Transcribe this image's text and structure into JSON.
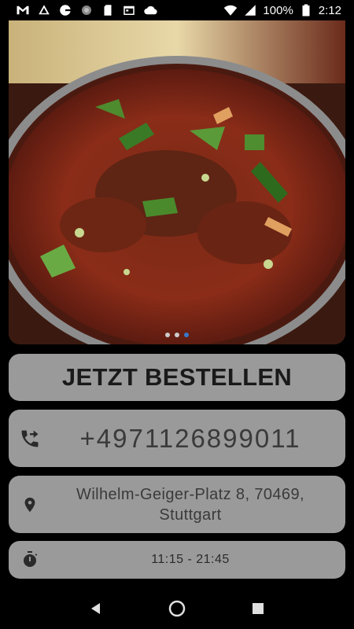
{
  "status_bar": {
    "battery_percent": "100%",
    "time": "2:12",
    "left_icons": [
      "gmail-icon",
      "drive-icon",
      "google-icon",
      "tracker-icon",
      "sd-card-icon",
      "calendar-icon",
      "cloud-icon"
    ],
    "right_icons": [
      "wifi-icon",
      "signal-icon",
      "battery-icon"
    ]
  },
  "hero": {
    "slide_count": 3,
    "active_slide": 3
  },
  "order": {
    "label": "JETZT BESTELLEN"
  },
  "contact": {
    "phone": "+4971126899011",
    "address_line1": "Wilhelm-Geiger-Platz 8, 70469,",
    "address_line2": "Stuttgart",
    "hours": "11:15 - 21:45"
  },
  "colors": {
    "card_bg": "#9a9a9a",
    "active_dot": "#3a78c9"
  }
}
